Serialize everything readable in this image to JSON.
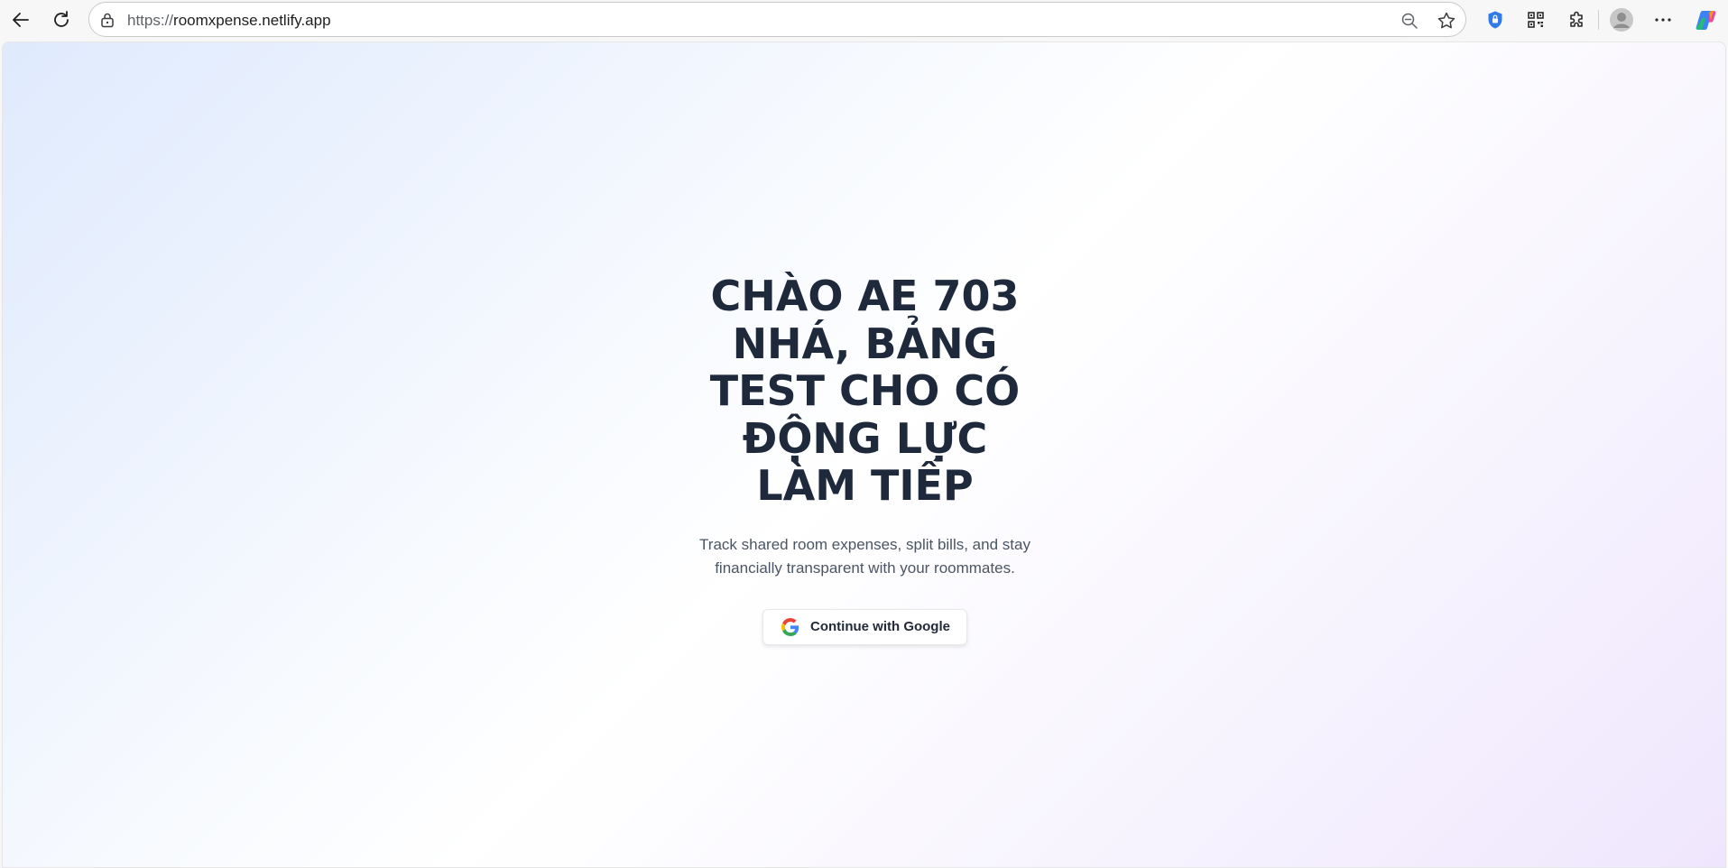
{
  "browser": {
    "url_scheme": "https://",
    "url_host": "roomxpense.netlify.app",
    "icons": {
      "back": "back-arrow-icon",
      "reload": "reload-icon",
      "site_info": "site-info-icon",
      "zoom": "zoom-out-icon",
      "favorite": "favorite-star-icon",
      "shield": "shield-icon",
      "qr": "qr-code-icon",
      "extensions": "extensions-icon",
      "profile": "profile-avatar-icon",
      "menu": "more-menu-icon",
      "copilot": "copilot-icon"
    }
  },
  "page": {
    "headline": "CHÀO AE 703 NHÁ, BẢNG TEST CHO CÓ ĐỘNG LỰC LÀM TIẾP",
    "subtitle": "Track shared room expenses, split bills, and stay financially transparent with your roommates.",
    "google_button_label": "Continue with Google"
  },
  "colors": {
    "headline": "#1e293b",
    "subtitle": "#4b5563",
    "gradient_start": "#dfeafd",
    "gradient_end": "#efe6fd"
  }
}
